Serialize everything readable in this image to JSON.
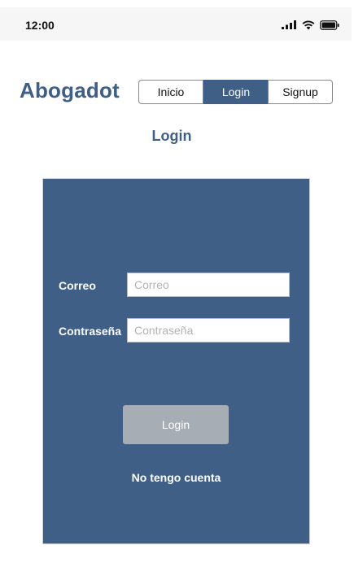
{
  "status_bar": {
    "time": "12:00",
    "icons": [
      "cellular-signal-icon",
      "wifi-icon",
      "battery-icon"
    ]
  },
  "brand": {
    "name": "Abogadot",
    "color": "#3f5f86"
  },
  "nav": {
    "tabs": [
      {
        "label": "Inicio",
        "active": false
      },
      {
        "label": "Login",
        "active": true
      },
      {
        "label": "Signup",
        "active": false
      }
    ]
  },
  "page": {
    "title": "Login"
  },
  "form": {
    "email_label": "Correo",
    "email_placeholder": "Correo",
    "email_value": "",
    "password_label": "Contraseña",
    "password_placeholder": "Contraseña",
    "password_value": "",
    "submit_label": "Login",
    "no_account_link": "No tengo cuenta"
  },
  "colors": {
    "primary": "#3f5f86",
    "button_disabled": "#a6adb5",
    "status_bar_bg": "#f6f6f6"
  }
}
